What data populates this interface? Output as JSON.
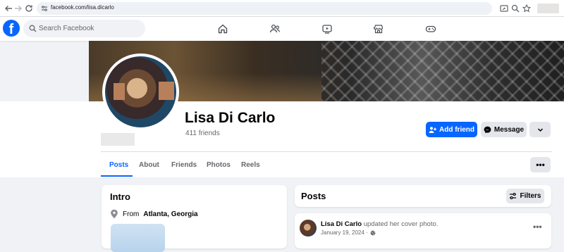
{
  "browser": {
    "url": "facebook.com/lisa.dicarlo"
  },
  "header": {
    "logo": "f",
    "search_placeholder": "Search Facebook",
    "nav_icons": [
      "home-icon",
      "friends-icon",
      "video-icon",
      "marketplace-icon",
      "gaming-icon"
    ]
  },
  "profile": {
    "name": "Lisa Di Carlo",
    "friends": "411 friends",
    "add_friend_label": "Add friend",
    "message_label": "Message",
    "more_label": "⌄"
  },
  "tabs": [
    {
      "label": "Posts",
      "active": true
    },
    {
      "label": "About",
      "active": false
    },
    {
      "label": "Friends",
      "active": false
    },
    {
      "label": "Photos",
      "active": false
    },
    {
      "label": "Reels",
      "active": false
    }
  ],
  "tabs_more_label": "•••",
  "intro": {
    "title": "Intro",
    "location_prefix": "From",
    "location": "Atlanta, Georgia"
  },
  "posts": {
    "title": "Posts",
    "filters_label": "Filters",
    "items": [
      {
        "author": "Lisa Di Carlo",
        "action": "updated her cover photo.",
        "date": "January 19, 2024 ·",
        "more_label": "•••"
      }
    ]
  },
  "colors": {
    "brand": "#0866ff",
    "background": "#f0f2f5",
    "secondary_button": "#e4e6eb"
  }
}
